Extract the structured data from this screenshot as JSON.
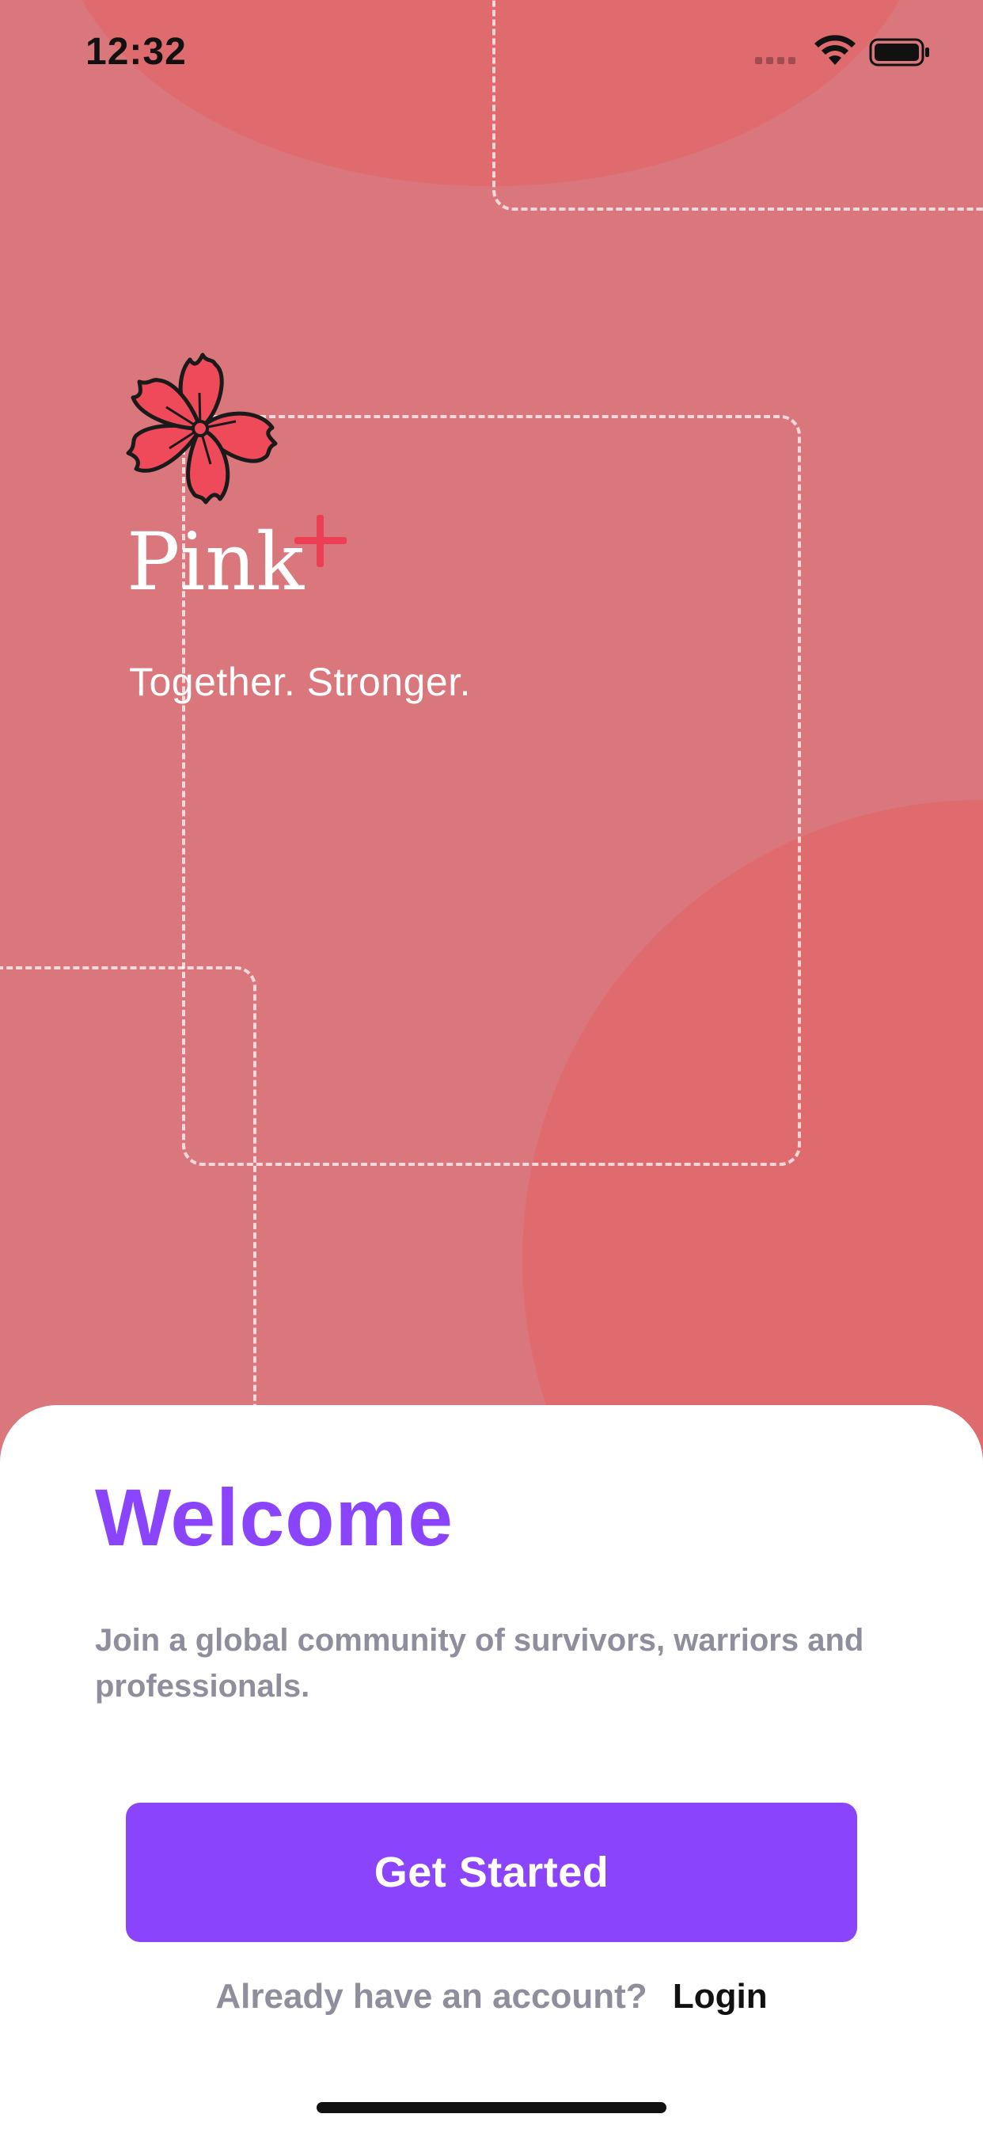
{
  "status_bar": {
    "time": "12:32"
  },
  "brand": {
    "name": "Pink",
    "tagline": "Together. Stronger.",
    "accent_color": "#ec3f55",
    "flower_color": "#ef4a5a"
  },
  "welcome": {
    "title": "Welcome",
    "description": "Join a global community of survivors, warriors and professionals.",
    "primary_button": "Get Started",
    "account_prompt": "Already have an account?",
    "login_link": "Login"
  },
  "colors": {
    "background": "#d9777c",
    "background_circle": "#df6b6f",
    "primary": "#8a44fb",
    "muted_text": "#8e8e9c"
  }
}
